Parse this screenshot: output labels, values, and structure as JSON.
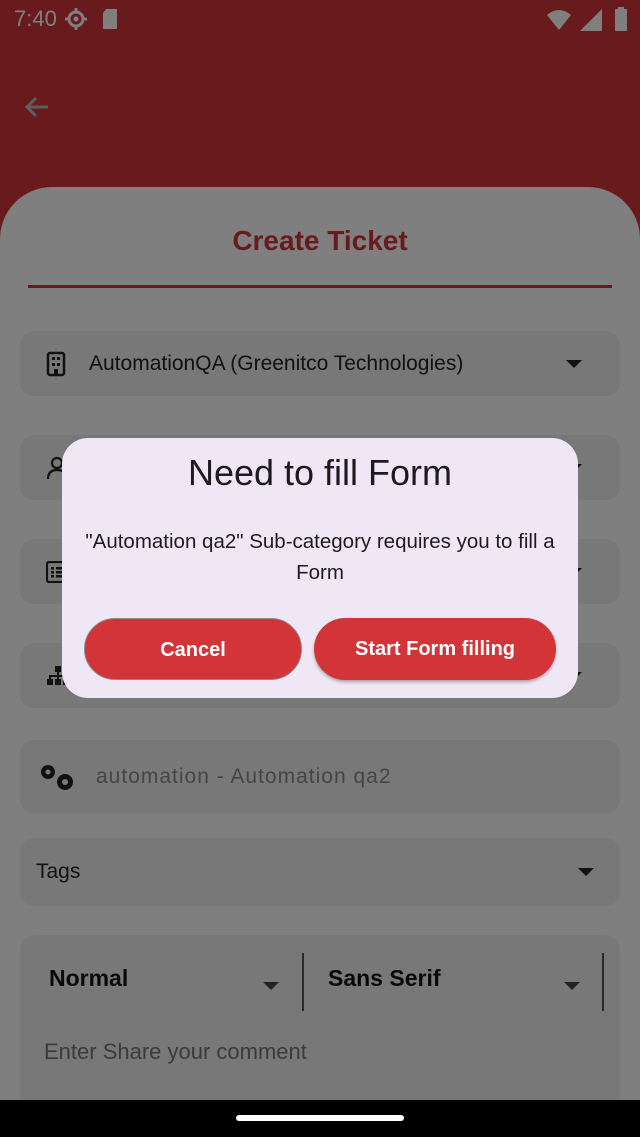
{
  "status_bar": {
    "time": "7:40"
  },
  "header": {
    "title": "Create Ticket"
  },
  "form": {
    "organization": "AutomationQA (Greenitco Technologies)",
    "subcategory": "automation - Automation qa2",
    "tags_label": "Tags",
    "editor": {
      "style_value": "Normal",
      "font_value": "Sans Serif",
      "placeholder": "Enter Share your comment"
    }
  },
  "dialog": {
    "title": "Need to fill Form",
    "message": "\"Automation qa2\" Sub-category requires you to fill a Form",
    "cancel_label": "Cancel",
    "start_label": "Start Form filling"
  },
  "colors": {
    "brand": "#d23438",
    "dialog_bg": "#efe7f5",
    "field_bg": "#f0f0f0"
  }
}
